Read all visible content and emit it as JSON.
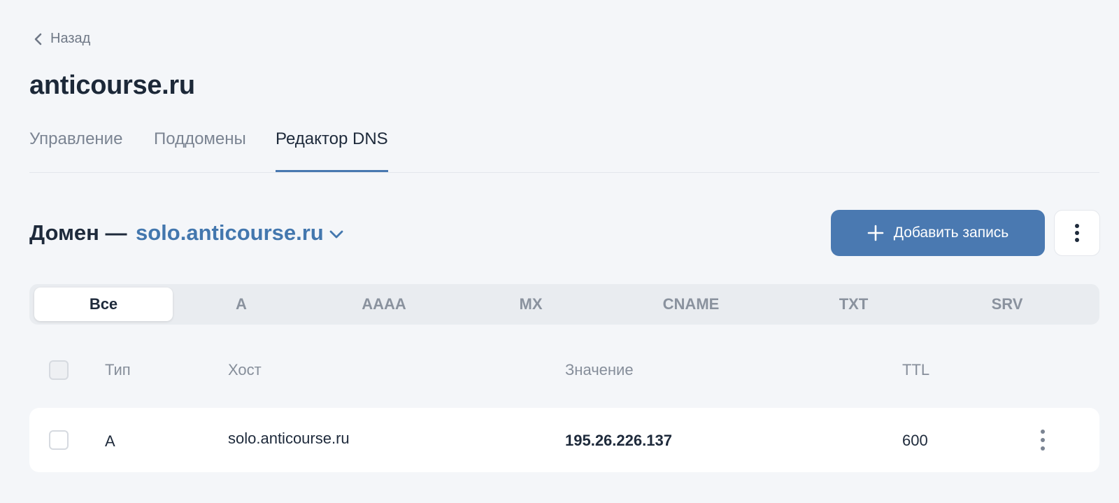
{
  "back": {
    "label": "Назад",
    "icon": "chevron-left-icon"
  },
  "page_title": "anticourse.ru",
  "tabs": [
    {
      "label": "Управление",
      "active": false
    },
    {
      "label": "Поддомены",
      "active": false
    },
    {
      "label": "Редактор DNS",
      "active": true
    }
  ],
  "domain": {
    "label": "Домен —",
    "selected": "solo.anticourse.ru",
    "icon": "chevron-down-icon"
  },
  "actions": {
    "add_label": "Добавить запись",
    "add_icon": "plus-icon",
    "more_icon": "more-vertical-icon"
  },
  "filter": {
    "items": [
      "Все",
      "A",
      "AAAA",
      "MX",
      "CNAME",
      "TXT",
      "SRV"
    ],
    "active": "Все"
  },
  "table": {
    "headers": {
      "type": "Тип",
      "host": "Хост",
      "value": "Значение",
      "ttl": "TTL"
    },
    "rows": [
      {
        "type": "A",
        "host": "solo.anticourse.ru",
        "value": "195.26.226.137",
        "ttl": "600"
      }
    ]
  },
  "colors": {
    "accent": "#4a79b1",
    "link": "#4377ae",
    "background": "#f4f6f9",
    "text": "#1e2a3b",
    "muted": "#868e9a"
  }
}
